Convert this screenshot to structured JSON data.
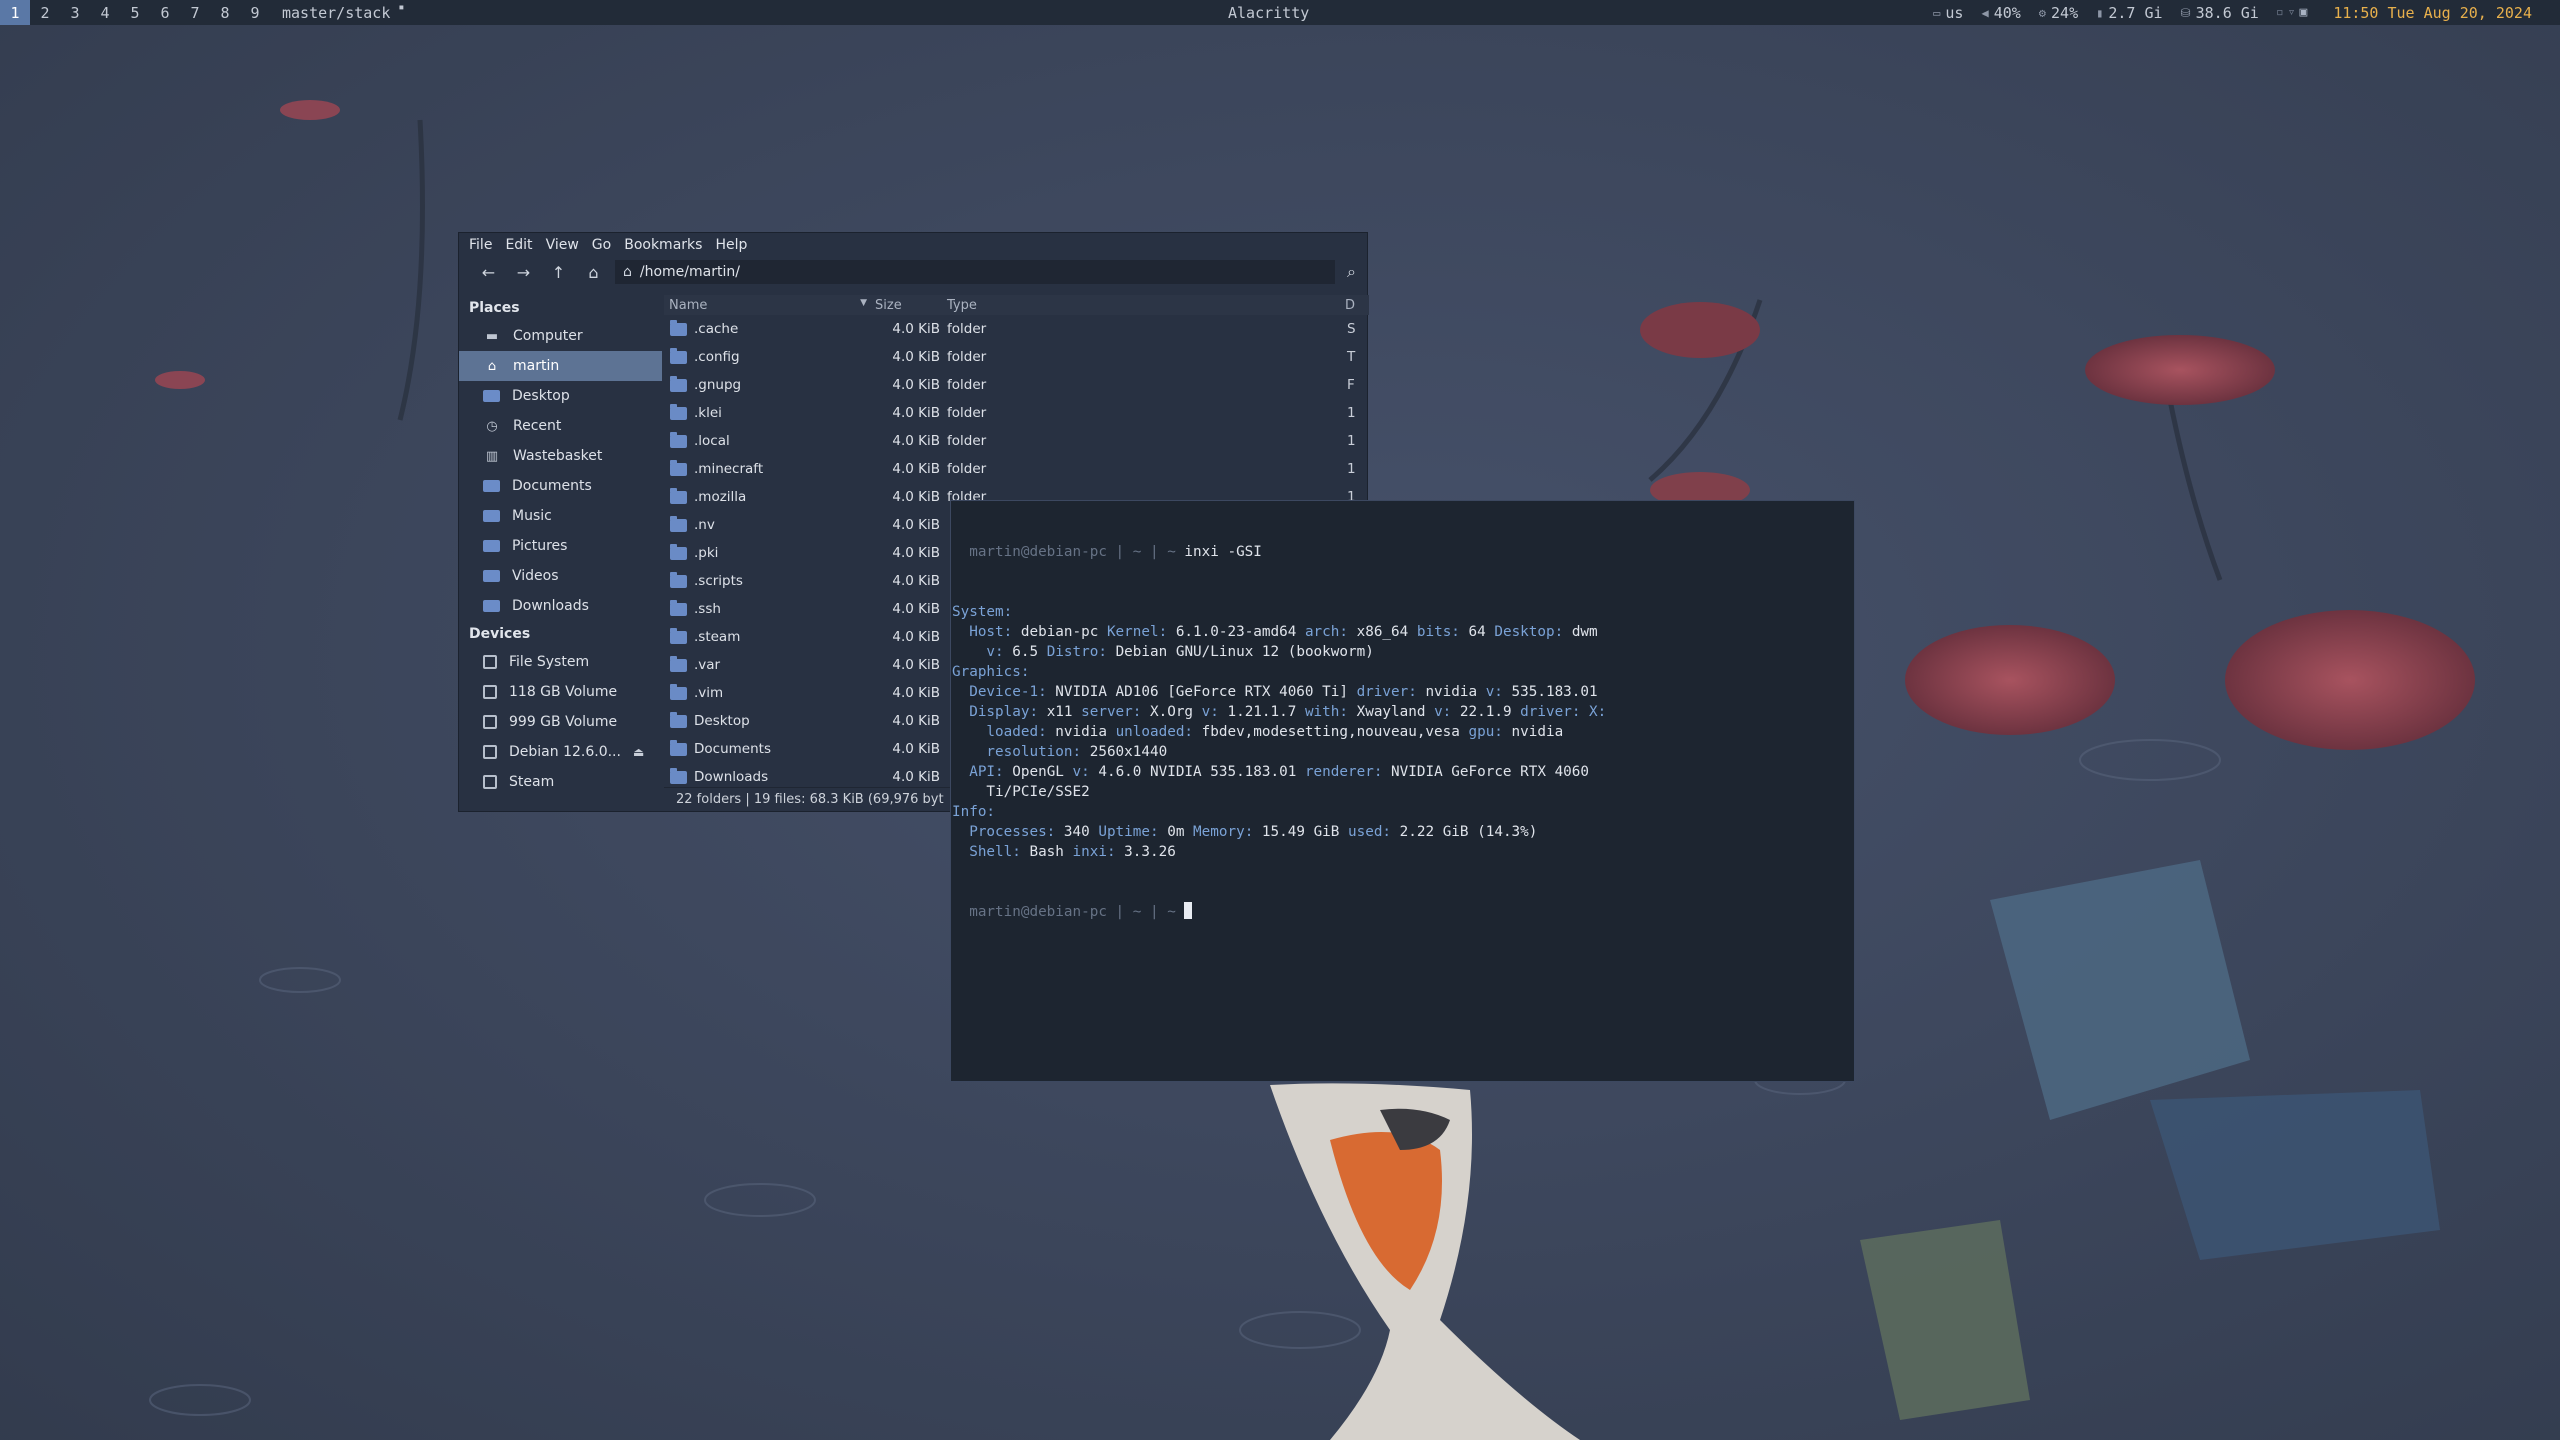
{
  "topbar": {
    "tags": [
      "1",
      "2",
      "3",
      "4",
      "5",
      "6",
      "7",
      "8",
      "9"
    ],
    "active_tag": "1",
    "layout": "master/stack",
    "window_title": "Alacritty",
    "status": {
      "keyboard": "us",
      "volume": "40%",
      "cpu": "24%",
      "memory": "2.7 Gi",
      "disk": "38.6 Gi",
      "clock": "11:50 Tue Aug 20, 2024"
    }
  },
  "file_manager": {
    "menu": [
      "File",
      "Edit",
      "View",
      "Go",
      "Bookmarks",
      "Help"
    ],
    "location": "/home/martin/",
    "sidebar": {
      "places_heading": "Places",
      "places": [
        "Computer",
        "martin",
        "Desktop",
        "Recent",
        "Wastebasket",
        "Documents",
        "Music",
        "Pictures",
        "Videos",
        "Downloads"
      ],
      "selected": "martin",
      "devices_heading": "Devices",
      "devices": [
        "File System",
        "118 GB Volume",
        "999 GB Volume",
        "Debian 12.6.0...",
        "Steam"
      ]
    },
    "columns": {
      "name": "Name",
      "size": "Size",
      "type": "Type",
      "extra": "D"
    },
    "files": [
      {
        "name": ".cache",
        "size": "4.0 KiB",
        "type": "folder",
        "extra": "S"
      },
      {
        "name": ".config",
        "size": "4.0 KiB",
        "type": "folder",
        "extra": "T"
      },
      {
        "name": ".gnupg",
        "size": "4.0 KiB",
        "type": "folder",
        "extra": "F"
      },
      {
        "name": ".klei",
        "size": "4.0 KiB",
        "type": "folder",
        "extra": "1"
      },
      {
        "name": ".local",
        "size": "4.0 KiB",
        "type": "folder",
        "extra": "1"
      },
      {
        "name": ".minecraft",
        "size": "4.0 KiB",
        "type": "folder",
        "extra": "1"
      },
      {
        "name": ".mozilla",
        "size": "4.0 KiB",
        "type": "folder",
        "extra": "1"
      },
      {
        "name": ".nv",
        "size": "4.0 KiB",
        "type": "",
        "extra": ""
      },
      {
        "name": ".pki",
        "size": "4.0 KiB",
        "type": "",
        "extra": ""
      },
      {
        "name": ".scripts",
        "size": "4.0 KiB",
        "type": "",
        "extra": ""
      },
      {
        "name": ".ssh",
        "size": "4.0 KiB",
        "type": "",
        "extra": ""
      },
      {
        "name": ".steam",
        "size": "4.0 KiB",
        "type": "",
        "extra": ""
      },
      {
        "name": ".var",
        "size": "4.0 KiB",
        "type": "",
        "extra": ""
      },
      {
        "name": ".vim",
        "size": "4.0 KiB",
        "type": "",
        "extra": ""
      },
      {
        "name": "Desktop",
        "size": "4.0 KiB",
        "type": "",
        "extra": ""
      },
      {
        "name": "Documents",
        "size": "4.0 KiB",
        "type": "",
        "extra": ""
      },
      {
        "name": "Downloads",
        "size": "4.0 KiB",
        "type": "",
        "extra": ""
      }
    ],
    "statusbar": "22 folders  |  19 files: 68.3 KiB (69,976 byt"
  },
  "terminal": {
    "prompt": "martin@debian-pc",
    "prompt_sep": " | ~ | ~ ",
    "command": "inxi -GSI",
    "lines": [
      [
        {
          "t": "System:",
          "c": "section"
        }
      ],
      [
        {
          "t": "  Host: ",
          "c": "key"
        },
        {
          "t": "debian-pc "
        },
        {
          "t": "Kernel: ",
          "c": "key"
        },
        {
          "t": "6.1.0-23-amd64 "
        },
        {
          "t": "arch: ",
          "c": "key"
        },
        {
          "t": "x86_64 "
        },
        {
          "t": "bits: ",
          "c": "key"
        },
        {
          "t": "64 "
        },
        {
          "t": "Desktop: ",
          "c": "key"
        },
        {
          "t": "dwm"
        }
      ],
      [
        {
          "t": "    v: ",
          "c": "key"
        },
        {
          "t": "6.5 "
        },
        {
          "t": "Distro: ",
          "c": "key"
        },
        {
          "t": "Debian GNU/Linux 12 (bookworm)"
        }
      ],
      [
        {
          "t": "Graphics:",
          "c": "section"
        }
      ],
      [
        {
          "t": "  Device-1: ",
          "c": "key"
        },
        {
          "t": "NVIDIA AD106 [GeForce RTX 4060 Ti] "
        },
        {
          "t": "driver: ",
          "c": "key"
        },
        {
          "t": "nvidia "
        },
        {
          "t": "v: ",
          "c": "key"
        },
        {
          "t": "535.183.01"
        }
      ],
      [
        {
          "t": "  Display: ",
          "c": "key"
        },
        {
          "t": "x11 "
        },
        {
          "t": "server: ",
          "c": "key"
        },
        {
          "t": "X.Org "
        },
        {
          "t": "v: ",
          "c": "key"
        },
        {
          "t": "1.21.1.7 "
        },
        {
          "t": "with: ",
          "c": "key"
        },
        {
          "t": "Xwayland "
        },
        {
          "t": "v: ",
          "c": "key"
        },
        {
          "t": "22.1.9 "
        },
        {
          "t": "driver: X:",
          "c": "key"
        }
      ],
      [
        {
          "t": "    loaded: ",
          "c": "key"
        },
        {
          "t": "nvidia "
        },
        {
          "t": "unloaded: ",
          "c": "key"
        },
        {
          "t": "fbdev,modesetting,nouveau,vesa "
        },
        {
          "t": "gpu: ",
          "c": "key"
        },
        {
          "t": "nvidia"
        }
      ],
      [
        {
          "t": "    resolution: ",
          "c": "key"
        },
        {
          "t": "2560x1440"
        }
      ],
      [
        {
          "t": "  API: ",
          "c": "key"
        },
        {
          "t": "OpenGL "
        },
        {
          "t": "v: ",
          "c": "key"
        },
        {
          "t": "4.6.0 NVIDIA 535.183.01 "
        },
        {
          "t": "renderer: ",
          "c": "key"
        },
        {
          "t": "NVIDIA GeForce RTX 4060"
        }
      ],
      [
        {
          "t": "    Ti/PCIe/SSE2"
        }
      ],
      [
        {
          "t": "Info:",
          "c": "section"
        }
      ],
      [
        {
          "t": "  Processes: ",
          "c": "key"
        },
        {
          "t": "340 "
        },
        {
          "t": "Uptime: ",
          "c": "key"
        },
        {
          "t": "0m "
        },
        {
          "t": "Memory: ",
          "c": "key"
        },
        {
          "t": "15.49 GiB "
        },
        {
          "t": "used: ",
          "c": "key"
        },
        {
          "t": "2.22 GiB (14.3%)"
        }
      ],
      [
        {
          "t": "  Shell: ",
          "c": "key"
        },
        {
          "t": "Bash "
        },
        {
          "t": "inxi: ",
          "c": "key"
        },
        {
          "t": "3.3.26"
        }
      ]
    ]
  },
  "colors": {
    "accent": "#5a78a6",
    "clock": "#e8b04c",
    "terminal_key": "#7aa2d6",
    "folder": "#6a8bc6"
  }
}
